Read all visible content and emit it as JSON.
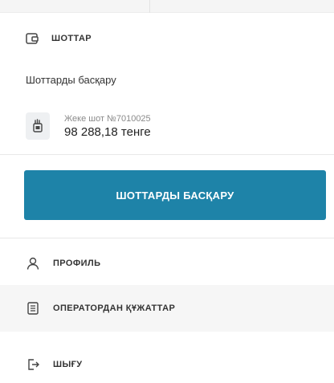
{
  "accounts": {
    "title": "ШОТТАР",
    "manage_link": "Шоттарды басқару",
    "items": [
      {
        "name": "Жеке шот №7010025",
        "balance": "98 288,18 тенге"
      }
    ],
    "manage_button": "ШОТТАРДЫ БАСҚАРУ"
  },
  "menu": {
    "profile": "ПРОФИЛЬ",
    "operator_docs": "ОПЕРАТОРДАН ҚҰЖАТТАР",
    "logout": "ШЫҒУ"
  },
  "colors": {
    "accent": "#1e83a8",
    "menu_highlight": "#f6f6f6"
  },
  "icons": {
    "accounts": "wallet-icon",
    "account_item": "account-card-icon",
    "profile": "user-icon",
    "documents": "document-icon",
    "logout": "logout-icon"
  }
}
